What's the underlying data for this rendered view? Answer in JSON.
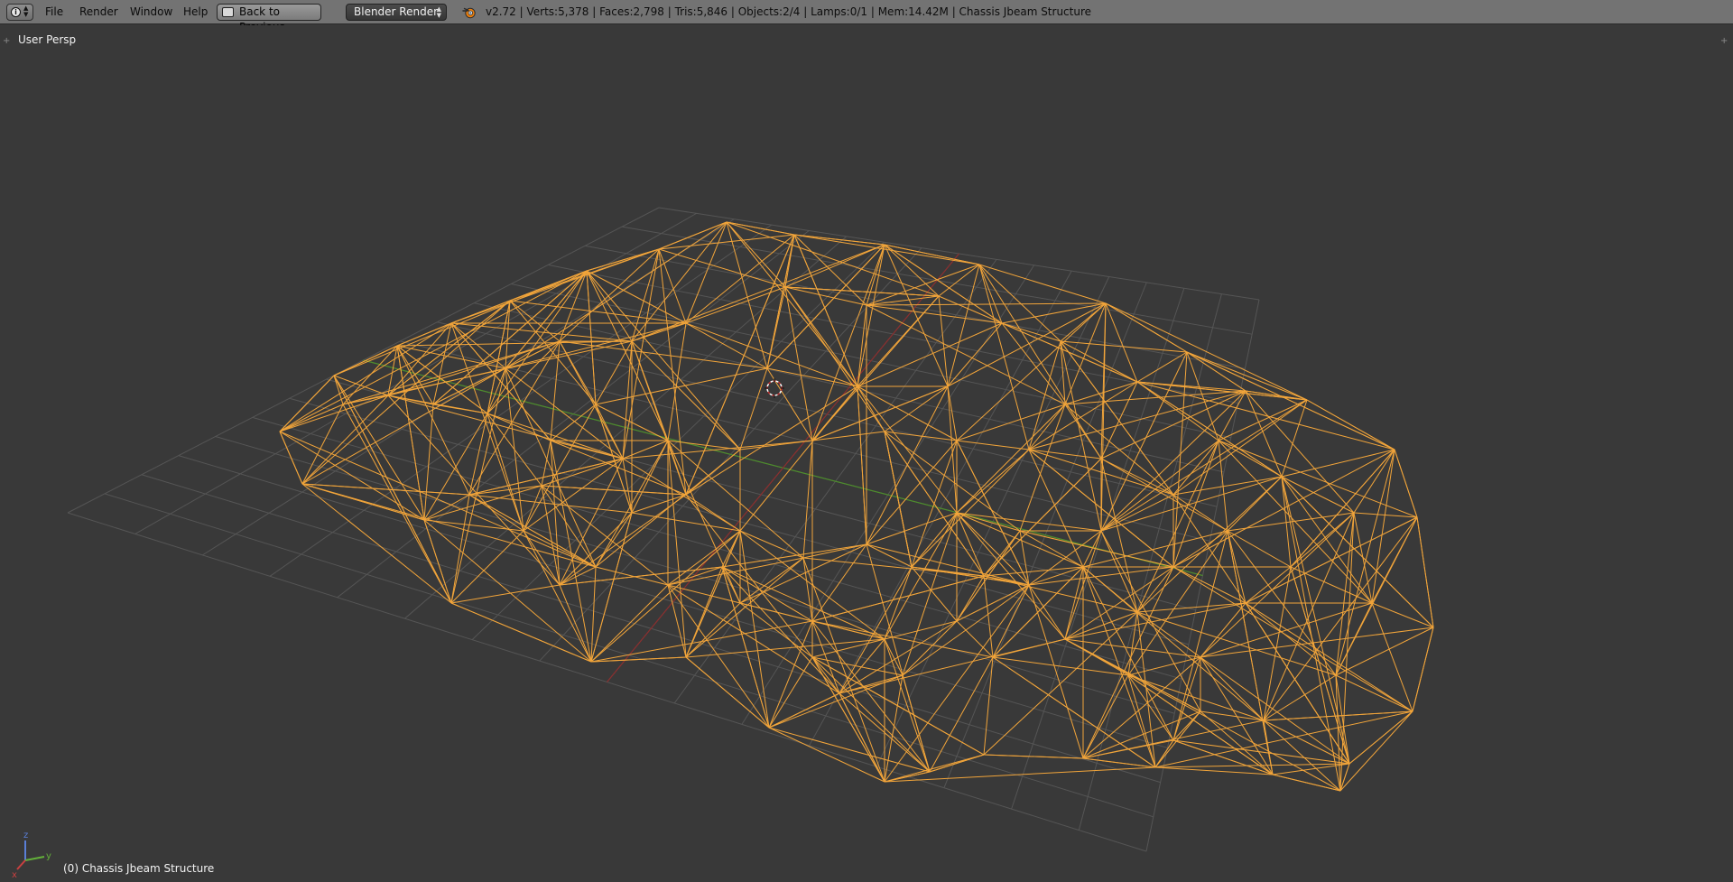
{
  "header": {
    "editor_type_icon": "info-icon",
    "menus": [
      {
        "label": "File"
      },
      {
        "label": "Render"
      },
      {
        "label": "Window"
      },
      {
        "label": "Help"
      }
    ],
    "back_button": {
      "label": "Back to Previous",
      "icon": "screen-back-icon"
    },
    "render_engine": {
      "selected": "Blender Render"
    },
    "stats": "v2.72 | Verts:5,378 | Faces:2,798 | Tris:5,846 | Objects:2/4 | Lamps:0/1 | Mem:14.42M | Chassis Jbeam Structure"
  },
  "viewport": {
    "view_label": "User Persp",
    "object_label": "(0) Chassis Jbeam Structure",
    "axes": {
      "x": "x",
      "y": "y",
      "z": "z"
    },
    "colors": {
      "background": "#393939",
      "grid": "#555555",
      "wire": "#f2a53a",
      "x_axis": "#8b2e2e",
      "y_axis": "#4d8c2c"
    }
  }
}
